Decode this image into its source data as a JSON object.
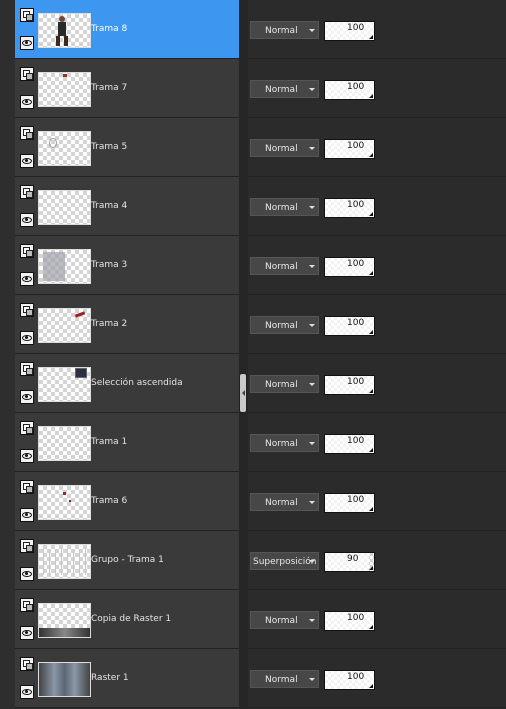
{
  "layers": [
    {
      "name": "Trama 8",
      "blend": "Normal",
      "opacity": "100",
      "selected": true,
      "thumb": "figure"
    },
    {
      "name": "Trama 7",
      "blend": "Normal",
      "opacity": "100",
      "selected": false,
      "thumb": "small-top"
    },
    {
      "name": "Trama 5",
      "blend": "Normal",
      "opacity": "100",
      "selected": false,
      "thumb": "ornament"
    },
    {
      "name": "Trama 4",
      "blend": "Normal",
      "opacity": "100",
      "selected": false,
      "thumb": "empty"
    },
    {
      "name": "Trama 3",
      "blend": "Normal",
      "opacity": "100",
      "selected": false,
      "thumb": "grey"
    },
    {
      "name": "Trama 2",
      "blend": "Normal",
      "opacity": "100",
      "selected": false,
      "thumb": "red-mark"
    },
    {
      "name": "Selección ascendida",
      "blend": "Normal",
      "opacity": "100",
      "selected": false,
      "thumb": "corner-box"
    },
    {
      "name": "Trama 1",
      "blend": "Normal",
      "opacity": "100",
      "selected": false,
      "thumb": "empty"
    },
    {
      "name": "Trama 6",
      "blend": "Normal",
      "opacity": "100",
      "selected": false,
      "thumb": "red-dots"
    },
    {
      "name": "Grupo - Trama 1",
      "blend": "Superposición",
      "opacity": "90",
      "selected": false,
      "thumb": "lines"
    },
    {
      "name": "Copia de Raster 1",
      "blend": "Normal",
      "opacity": "100",
      "selected": false,
      "thumb": "bottom-dark"
    },
    {
      "name": "Raster 1",
      "blend": "Normal",
      "opacity": "100",
      "selected": false,
      "thumb": "dark"
    }
  ],
  "icons": {
    "layer_type": "layer-type-icon",
    "visibility": "eye-icon",
    "dropdown": "chevron-down-icon"
  },
  "colors": {
    "selected_row": "#3d97f0",
    "row_bg": "#3a3a3a",
    "panel_bg": "#2b2b2b"
  }
}
